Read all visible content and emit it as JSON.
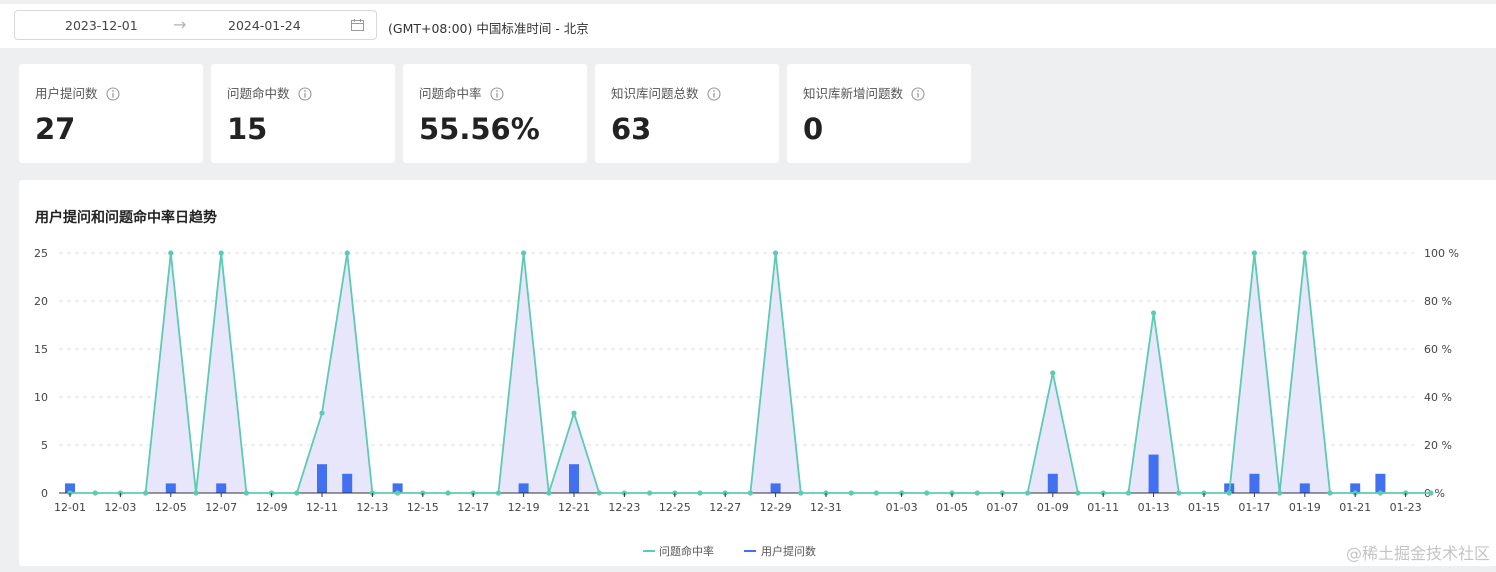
{
  "filter": {
    "start_date": "2023-12-01",
    "end_date": "2024-01-24",
    "timezone": "(GMT+08:00) 中国标准时间 - 北京"
  },
  "stats": [
    {
      "label": "用户提问数",
      "value": "27"
    },
    {
      "label": "问题命中数",
      "value": "15"
    },
    {
      "label": "问题命中率",
      "value": "55.56%"
    },
    {
      "label": "知识库问题总数",
      "value": "63"
    },
    {
      "label": "知识库新增问题数",
      "value": "0"
    }
  ],
  "chart_title": "用户提问和问题命中率日趋势",
  "chart_data": {
    "type": "bar",
    "title": "用户提问和问题命中率日趋势",
    "categories": [
      "12-01",
      "12-02",
      "12-03",
      "12-04",
      "12-05",
      "12-06",
      "12-07",
      "12-08",
      "12-09",
      "12-10",
      "12-11",
      "12-12",
      "12-13",
      "12-14",
      "12-15",
      "12-16",
      "12-17",
      "12-18",
      "12-19",
      "12-20",
      "12-21",
      "12-22",
      "12-23",
      "12-24",
      "12-25",
      "12-26",
      "12-27",
      "12-28",
      "12-29",
      "12-30",
      "12-31",
      "01-01",
      "01-02",
      "01-03",
      "01-04",
      "01-05",
      "01-06",
      "01-07",
      "01-08",
      "01-09",
      "01-10",
      "01-11",
      "01-12",
      "01-13",
      "01-14",
      "01-15",
      "01-16",
      "01-17",
      "01-18",
      "01-19",
      "01-20",
      "01-21",
      "01-22",
      "01-23",
      "01-24"
    ],
    "x_tick_labels": [
      "12-01",
      "12-03",
      "12-05",
      "12-07",
      "12-09",
      "12-11",
      "12-13",
      "12-15",
      "12-17",
      "12-19",
      "12-21",
      "12-23",
      "12-25",
      "12-27",
      "12-29",
      "12-31",
      "01-03",
      "01-05",
      "01-07",
      "01-09",
      "01-11",
      "01-13",
      "01-15",
      "01-17",
      "01-19",
      "01-21",
      "01-23"
    ],
    "series": [
      {
        "name": "问题命中率",
        "type": "area-line",
        "axis": "right",
        "color": "#5ccbb1",
        "fill": "#e8e6fb",
        "values": [
          0,
          0,
          0,
          0,
          100,
          0,
          100,
          0,
          0,
          0,
          33.3,
          100,
          0,
          0,
          0,
          0,
          0,
          0,
          100,
          0,
          33.3,
          0,
          0,
          0,
          0,
          0,
          0,
          0,
          100,
          0,
          0,
          0,
          0,
          0,
          0,
          0,
          0,
          0,
          0,
          50,
          0,
          0,
          0,
          75,
          0,
          0,
          0,
          100,
          0,
          100,
          0,
          0,
          0,
          0,
          0
        ]
      },
      {
        "name": "用户提问数",
        "type": "bar",
        "axis": "left",
        "color": "#4170f0",
        "values": [
          1,
          0,
          0,
          0,
          1,
          0,
          1,
          0,
          0,
          0,
          3,
          2,
          0,
          1,
          0,
          0,
          0,
          0,
          1,
          0,
          3,
          0,
          0,
          0,
          0,
          0,
          0,
          0,
          1,
          0,
          0,
          0,
          0,
          0,
          0,
          0,
          0,
          0,
          0,
          2,
          0,
          0,
          0,
          4,
          0,
          0,
          1,
          2,
          0,
          1,
          0,
          1,
          2,
          0,
          0
        ]
      }
    ],
    "y_left": {
      "min": 0,
      "max": 25,
      "ticks": [
        "0",
        "5",
        "10",
        "15",
        "20",
        "25"
      ]
    },
    "y_right": {
      "min": 0,
      "max": 100,
      "ticks": [
        "0 %",
        "20 %",
        "40 %",
        "60 %",
        "80 %",
        "100 %"
      ]
    },
    "grid": true,
    "legend_position": "bottom-center"
  },
  "legend": [
    {
      "label": "问题命中率",
      "color": "#5ccbb1"
    },
    {
      "label": "用户提问数",
      "color": "#4170f0"
    }
  ],
  "watermark": "@稀土掘金技术社区"
}
